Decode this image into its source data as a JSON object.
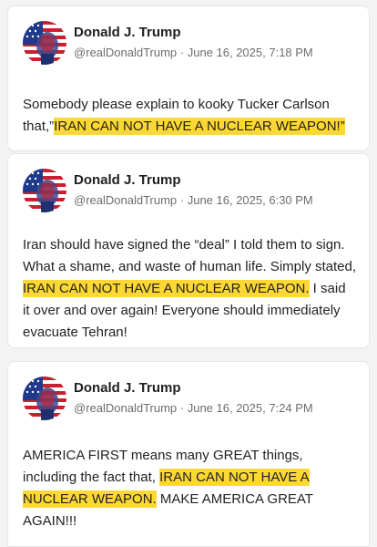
{
  "colors": {
    "highlight": "#fdd835",
    "card_background": "#ffffff",
    "page_background": "#f3f3f3"
  },
  "posts": [
    {
      "author": "Donald J. Trump",
      "handle": "@realDonaldTrump",
      "separator": " · ",
      "timestamp": "June 16, 2025, 7:18 PM",
      "text_before": "Somebody please explain to kooky Tucker Carlson that,”",
      "text_highlight": "IRAN CAN NOT HAVE A NUCLEAR WEAPON!”",
      "text_after": ""
    },
    {
      "author": "Donald J. Trump",
      "handle": "@realDonaldTrump",
      "separator": " · ",
      "timestamp": "June 16, 2025, 6:30 PM",
      "text_before": "Iran should have signed the “deal” I told them to sign. What a shame, and waste of human life. Simply stated, ",
      "text_highlight": "IRAN CAN NOT HAVE A NUCLEAR WEAPON.",
      "text_after": " I said it over and over again! Everyone should immediately evacuate Tehran!"
    },
    {
      "author": "Donald J. Trump",
      "handle": "@realDonaldTrump",
      "separator": " · ",
      "timestamp": "June 16, 2025, 7:24 PM",
      "text_before": "AMERICA FIRST means many GREAT things, including the fact that, ",
      "text_highlight": "IRAN CAN NOT HAVE A NUCLEAR WEAPON.",
      "text_after": " MAKE AMERICA GREAT AGAIN!!!"
    }
  ]
}
